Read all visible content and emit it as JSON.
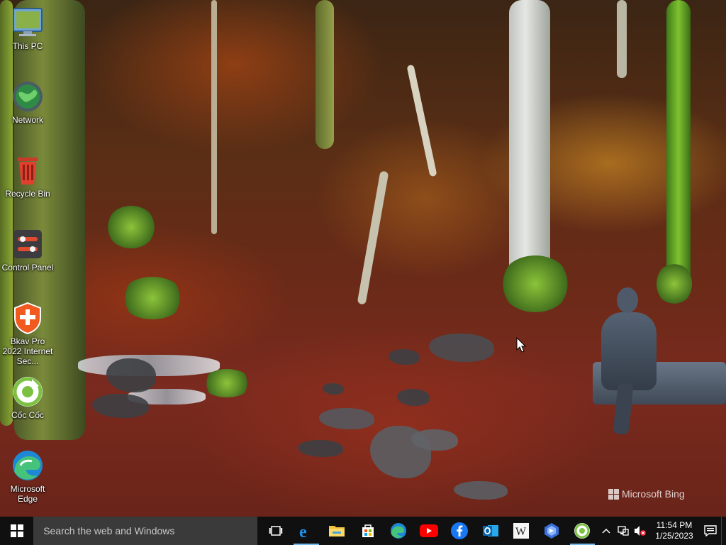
{
  "desktop": {
    "icons": [
      {
        "label": "This PC",
        "icon": "this-pc-icon"
      },
      {
        "label": "Network",
        "icon": "network-icon"
      },
      {
        "label": "Recycle Bin",
        "icon": "recycle-bin-icon"
      },
      {
        "label": "Control Panel",
        "icon": "control-panel-icon"
      },
      {
        "label": "Bkav Pro 2022 Internet Sec...",
        "icon": "bkav-icon"
      },
      {
        "label": "Cốc Cốc",
        "icon": "coccoc-icon"
      },
      {
        "label": "Microsoft Edge",
        "icon": "edge-icon"
      }
    ],
    "watermark": "Microsoft Bing"
  },
  "taskbar": {
    "search_placeholder": "Search the web and Windows",
    "pinned_apps": [
      {
        "name": "Task View",
        "icon": "task-view-icon"
      },
      {
        "name": "Internet Explorer",
        "icon": "ie-icon"
      },
      {
        "name": "File Explorer",
        "icon": "file-explorer-icon"
      },
      {
        "name": "Microsoft Store",
        "icon": "store-icon"
      },
      {
        "name": "Microsoft Edge",
        "icon": "edge-icon"
      },
      {
        "name": "YouTube",
        "icon": "youtube-icon"
      },
      {
        "name": "Facebook",
        "icon": "facebook-icon"
      },
      {
        "name": "Outlook",
        "icon": "outlook-icon"
      },
      {
        "name": "Wikipedia",
        "icon": "wikipedia-icon"
      },
      {
        "name": "Power Automate",
        "icon": "power-automate-icon"
      },
      {
        "name": "Cốc Cốc",
        "icon": "coccoc-icon"
      }
    ],
    "clock": {
      "time": "11:54 PM",
      "date": "1/25/2023"
    }
  },
  "colors": {
    "taskbar": "#101010",
    "search_box": "#3a3a3a",
    "active_underline": "#76b9ed"
  }
}
